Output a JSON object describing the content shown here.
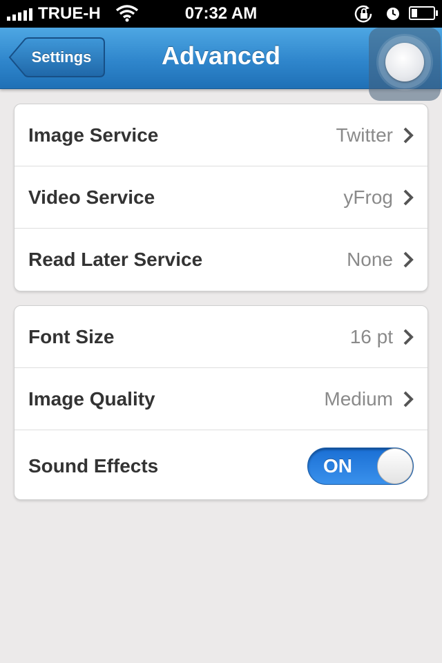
{
  "status_bar": {
    "carrier": "TRUE-H",
    "time": "07:32 AM",
    "battery_level": 0.25,
    "icons": [
      "signal-icon",
      "wifi-icon",
      "rotation-lock-icon",
      "alarm-icon",
      "battery-icon"
    ]
  },
  "nav": {
    "back_label": "Settings",
    "title": "Advanced",
    "assistive_touch_icon": "assistive-touch-icon"
  },
  "groups": [
    {
      "rows": [
        {
          "label": "Image Service",
          "value": "Twitter"
        },
        {
          "label": "Video Service",
          "value": "yFrog"
        },
        {
          "label": "Read Later Service",
          "value": "None"
        }
      ]
    },
    {
      "rows": [
        {
          "label": "Font Size",
          "value": "16 pt"
        },
        {
          "label": "Image Quality",
          "value": "Medium"
        },
        {
          "label": "Sound Effects",
          "toggle": "ON"
        }
      ]
    }
  ],
  "colors": {
    "nav_blue": "#2f86cc",
    "toggle_blue": "#2a80e0",
    "background": "#eceaea"
  }
}
